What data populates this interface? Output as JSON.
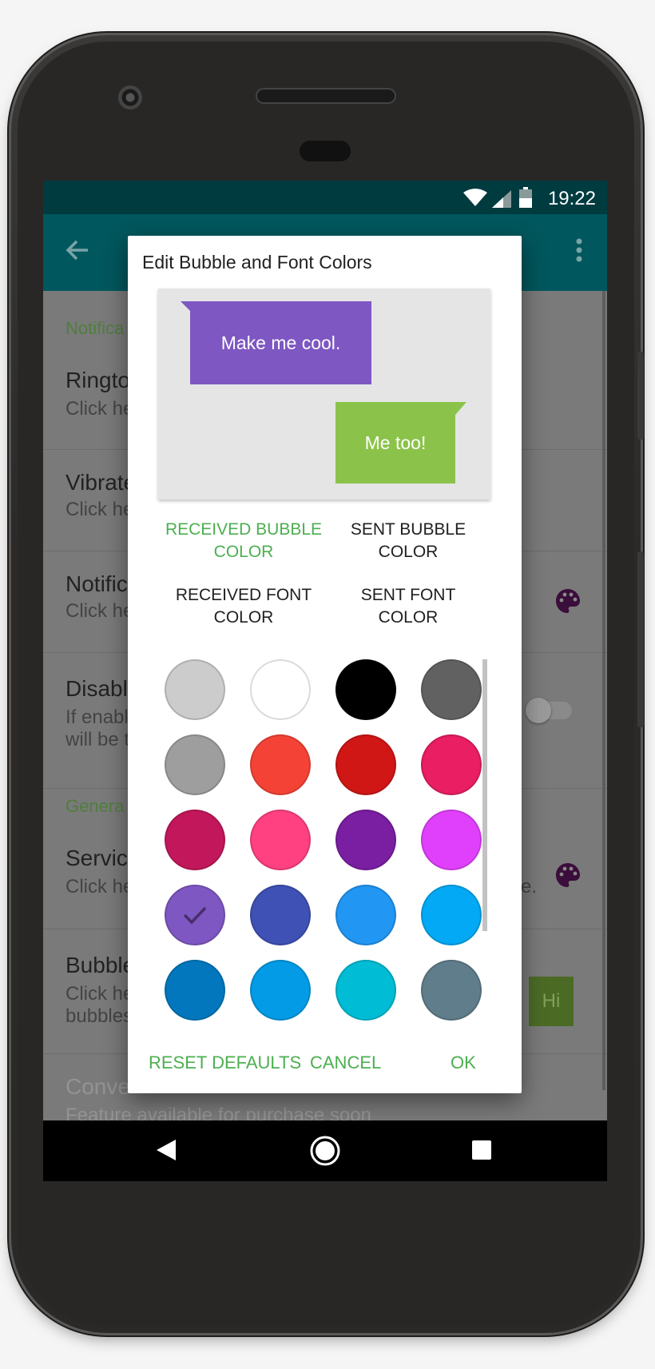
{
  "status_bar": {
    "time": "19:22"
  },
  "settings": {
    "header_notifications": "Notifica",
    "header_general": "Genera",
    "rows": [
      {
        "title": "Ringto",
        "subtitle": "Click he"
      },
      {
        "title": "Vibrate",
        "subtitle": "Click he"
      },
      {
        "title": "Notific",
        "subtitle": "Click he",
        "icon": "palette-icon"
      },
      {
        "title": "Disabl",
        "subtitle_line1": "If enabl",
        "subtitle_line2": "will be t"
      },
      {
        "title": "Servic",
        "subtitle": "Click he",
        "trailing_fragment": "e.",
        "icon": "palette-icon"
      },
      {
        "title": "Bubble",
        "subtitle_line1": "Click he",
        "subtitle_line2": "bubbles",
        "preview_text": "Hi"
      },
      {
        "title": "Conve",
        "subtitle": "Feature available for purchase soon"
      }
    ]
  },
  "dialog": {
    "title": "Edit Bubble and Font Colors",
    "preview": {
      "received_text": "Make me cool.",
      "sent_text": "Me too!"
    },
    "options": {
      "received_bubble_line1": "RECEIVED BUBBLE",
      "received_bubble_line2": "COLOR",
      "sent_bubble_line1": "SENT BUBBLE",
      "sent_bubble_line2": "COLOR",
      "received_font_line1": "RECEIVED FONT",
      "received_font_line2": "COLOR",
      "sent_font_line1": "SENT FONT",
      "sent_font_line2": "COLOR",
      "active": "received_bubble"
    },
    "swatches": [
      "#cccccc",
      "#ffffff",
      "#000000",
      "#616161",
      "#9e9e9e",
      "#f44336",
      "#d01716",
      "#e91e63",
      "#c2185b",
      "#ff4081",
      "#7b1fa2",
      "#e040fb",
      "#7e57c2",
      "#3f51b5",
      "#2196f3",
      "#03a9f4",
      "#0277bd",
      "#039be5",
      "#00bcd4",
      "#607d8b"
    ],
    "selected_swatch": "#7e57c2",
    "actions": {
      "reset": "RESET DEFAULTS",
      "cancel": "CANCEL",
      "ok": "OK"
    }
  },
  "colors": {
    "accent": "#4caf50",
    "app_bar": "#00575d",
    "status_bar": "#003b40"
  }
}
